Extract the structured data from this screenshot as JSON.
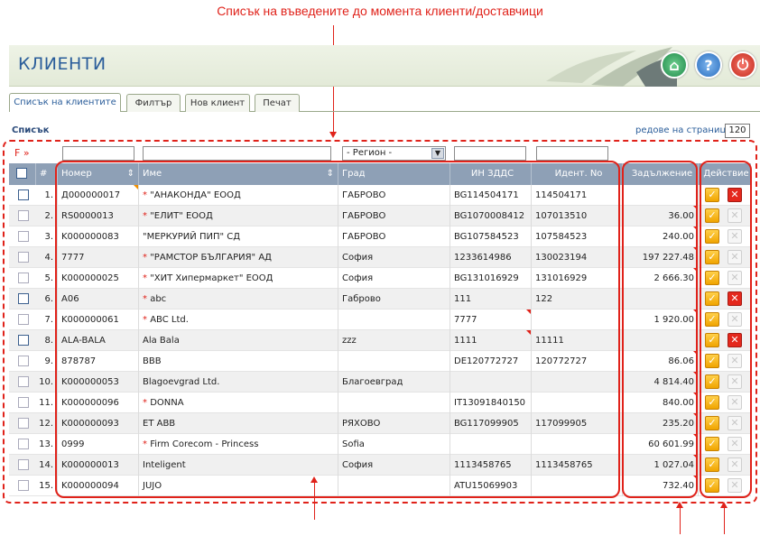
{
  "annotation": {
    "top_caption": "Списък на въведените до момента клиенти/доставчици"
  },
  "header": {
    "title": "КЛИЕНТИ"
  },
  "tabs": [
    {
      "label": "Списък на клиентите"
    },
    {
      "label": "Филтър"
    },
    {
      "label": "Нов клиент"
    },
    {
      "label": "Печат"
    }
  ],
  "list": {
    "label": "Списък",
    "rows_per_page_label": "редове на страница »",
    "rows_per_page": "120"
  },
  "filter": {
    "label": "F »",
    "region_placeholder": "- Регион -"
  },
  "columns": {
    "num": "#",
    "code": "Номер",
    "name": "Име",
    "city": "Град",
    "vat": "ИН ЗДДС",
    "ident": "Идент. No",
    "debt": "Задължение",
    "action": "Действие"
  },
  "rows": [
    {
      "n": "1.",
      "code": "Д000000017",
      "star": "*",
      "name": "\"АНАКОНДА\" ЕООД",
      "city": "ГАБРОВО",
      "vat": "BG114504171",
      "ident": "114504171",
      "debt": "",
      "del": "active"
    },
    {
      "n": "2.",
      "code": "RS0000013",
      "star": "*",
      "name": "\"ЕЛИТ\" ЕООД",
      "city": "ГАБРОВО",
      "vat": "BG1070008412",
      "ident": "107013510",
      "debt": "36.00",
      "del": "off"
    },
    {
      "n": "3.",
      "code": "K000000083",
      "star": "",
      "name": "\"МЕРКУРИЙ ПИП\" СД",
      "city": "ГАБРОВО",
      "vat": "BG107584523",
      "ident": "107584523",
      "debt": "240.00",
      "del": "off"
    },
    {
      "n": "4.",
      "code": "7777",
      "star": "*",
      "name": "\"РАМСТОР БЪЛГАРИЯ\" АД",
      "city": "София",
      "vat": "1233614986",
      "ident": "130023194",
      "debt": "197 227.48",
      "del": "off"
    },
    {
      "n": "5.",
      "code": "K000000025",
      "star": "*",
      "name": "\"ХИТ Хипермаркет\" ЕООД",
      "city": "София",
      "vat": "BG131016929",
      "ident": "131016929",
      "debt": "2 666.30",
      "del": "off"
    },
    {
      "n": "6.",
      "code": "A06",
      "star": "*",
      "name": "abc",
      "city": "Габрово",
      "vat": "111",
      "ident": "122",
      "debt": "",
      "del": "active"
    },
    {
      "n": "7.",
      "code": "K000000061",
      "star": "*",
      "name": "ABC Ltd.",
      "city": "",
      "vat": "7777",
      "ident": "",
      "debt": "1 920.00",
      "del": "off"
    },
    {
      "n": "8.",
      "code": "ALA-BALA",
      "star": "",
      "name": "Ala Bala",
      "city": "zzz",
      "vat": "1111",
      "ident": "11111",
      "debt": "",
      "del": "active"
    },
    {
      "n": "9.",
      "code": "878787",
      "star": "",
      "name": "BBB",
      "city": "",
      "vat": "DE120772727",
      "ident": "120772727",
      "debt": "86.06",
      "del": "off"
    },
    {
      "n": "10.",
      "code": "K000000053",
      "star": "",
      "name": "Blagoevgrad Ltd.",
      "city": "Благоевград",
      "vat": "",
      "ident": "",
      "debt": "4 814.40",
      "del": "off"
    },
    {
      "n": "11.",
      "code": "K000000096",
      "star": "*",
      "name": "DONNA",
      "city": "",
      "vat": "IT13091840150",
      "ident": "",
      "debt": "840.00",
      "del": "off"
    },
    {
      "n": "12.",
      "code": "K000000093",
      "star": "",
      "name": "ET ABB",
      "city": "РЯХОВО",
      "vat": "BG117099905",
      "ident": "117099905",
      "debt": "235.20",
      "del": "off"
    },
    {
      "n": "13.",
      "code": "0999",
      "star": "*",
      "name": "Firm Corecom - Princess",
      "city": "Sofia",
      "vat": "",
      "ident": "",
      "debt": "60 601.99",
      "del": "off"
    },
    {
      "n": "14.",
      "code": "K000000013",
      "star": "",
      "name": "Inteligent",
      "city": "София",
      "vat": "1113458765",
      "ident": "1113458765",
      "debt": "1 027.04",
      "del": "off"
    },
    {
      "n": "15.",
      "code": "K000000094",
      "star": "",
      "name": "JUJO",
      "city": "",
      "vat": "ATU15069903",
      "ident": "",
      "debt": "732.40",
      "del": "off"
    }
  ],
  "colors": {
    "accent": "#e0221a",
    "header_bg": "#8ea0b6",
    "title": "#2a5d9a"
  }
}
